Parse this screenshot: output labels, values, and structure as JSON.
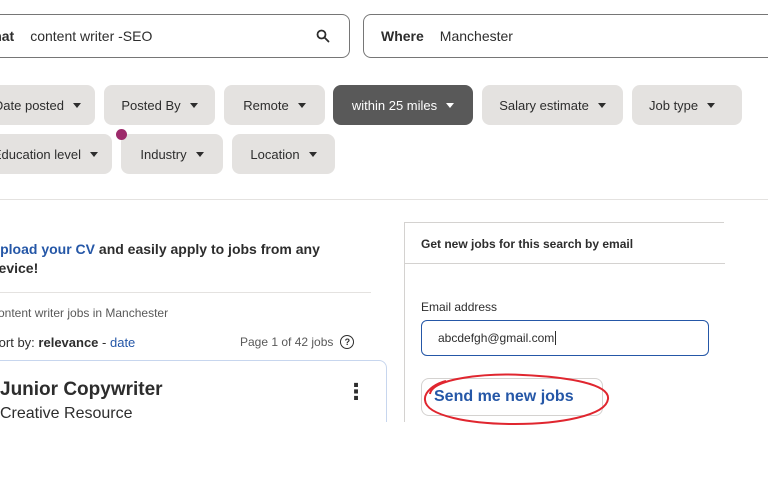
{
  "search": {
    "what_label": "What",
    "what_value": "content writer -SEO",
    "where_label": "Where",
    "where_value": "Manchester"
  },
  "filters": [
    {
      "label": "Date posted",
      "active": false
    },
    {
      "label": "Posted By",
      "active": false
    },
    {
      "label": "Remote",
      "active": false
    },
    {
      "label": "within 25 miles",
      "active": true
    },
    {
      "label": "Salary estimate",
      "active": false
    },
    {
      "label": "Job type",
      "active": false
    },
    {
      "label": "Education level",
      "active": false
    },
    {
      "label": "Industry",
      "active": false
    },
    {
      "label": "Location",
      "active": false
    }
  ],
  "upload": {
    "link_text": "Upload your CV",
    "rest_line1": " and easily apply to jobs from any",
    "rest_line2": "device!"
  },
  "results": {
    "summary": "content writer jobs in Manchester",
    "sort_label": "Sort by:",
    "sort_active": "relevance",
    "sort_separator": " - ",
    "sort_other": "date",
    "page_info": "Page 1 of 42 jobs",
    "help_icon": "?"
  },
  "job": {
    "title": "Junior Copywriter",
    "company": "Creative Resource",
    "more_icon": "⋮"
  },
  "alert": {
    "heading": "Get new jobs for this search by email",
    "email_label": "Email address",
    "email_value": "abcdefgh@gmail.com",
    "button": "Send me new jobs"
  },
  "colors": {
    "link": "#2557a7",
    "chip": "#e4e2e0",
    "chip_active": "#595959",
    "badge_dot": "#9d2b6b",
    "annotation": "#e0262f"
  }
}
